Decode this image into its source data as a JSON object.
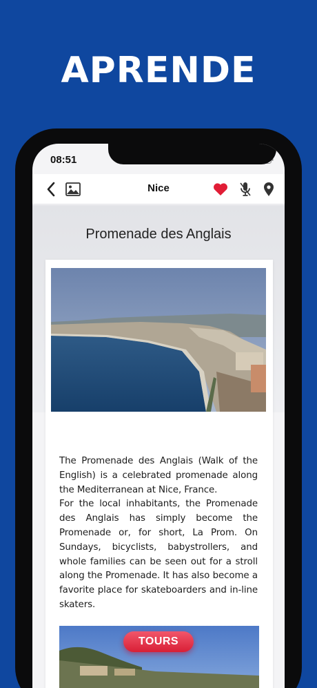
{
  "promo": {
    "headline": "APRENDE"
  },
  "status_bar": {
    "time": "08:51"
  },
  "nav": {
    "title": "Nice",
    "back_icon": "chevron-left-icon",
    "gallery_icon": "image-icon",
    "favorite_icon": "heart-icon",
    "audio_icon": "microphone-icon",
    "map_icon": "location-pin-icon"
  },
  "page": {
    "title": "Promenade des Anglais"
  },
  "description": {
    "paragraph1": "The Promenade des Anglais (Walk of the English) is a celebrated promenade along the Mediterranean at Nice, France.",
    "paragraph2": "For the local inhabitants, the Promenade des Anglais has simply become the Promenade or, for short, La Prom. On Sundays, bicyclists, babystrollers, and whole families can be seen out for a stroll along the Promenade. It has also become a favorite place for skateboarders and in-line skaters."
  },
  "tours_button": {
    "label": "TOURS"
  },
  "colors": {
    "background": "#0f479f",
    "favorite": "#e11d36",
    "tours_button": "#e0273d"
  }
}
